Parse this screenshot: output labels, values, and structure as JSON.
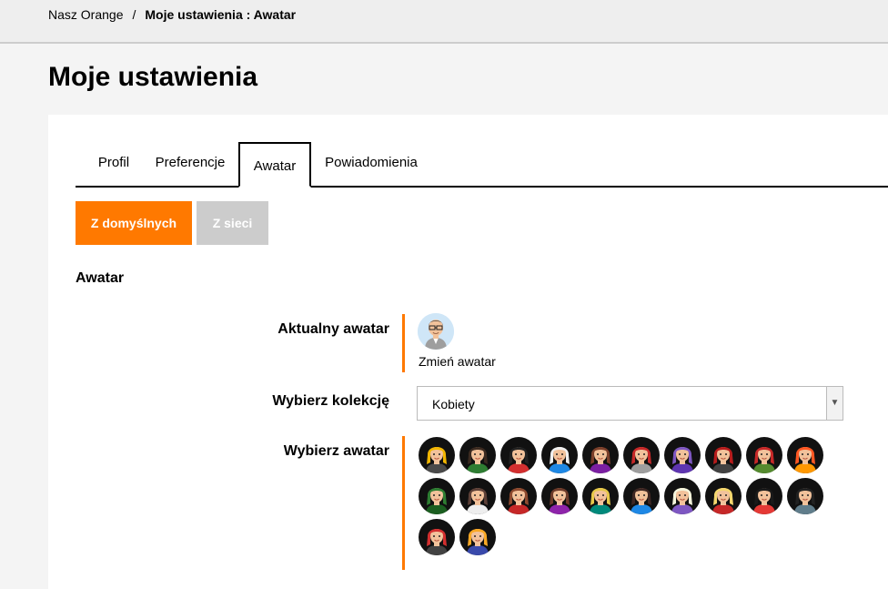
{
  "breadcrumb": {
    "home": "Nasz Orange",
    "separator": "/",
    "current": "Moje ustawienia : Awatar"
  },
  "page_title": "Moje ustawienia",
  "tabs": [
    {
      "label": "Profil",
      "active": false
    },
    {
      "label": "Preferencje",
      "active": false
    },
    {
      "label": "Awatar",
      "active": true
    },
    {
      "label": "Powiadomienia",
      "active": false
    }
  ],
  "source_buttons": {
    "defaults": "Z domyślnych",
    "web": "Z sieci"
  },
  "section_title": "Awatar",
  "current_avatar": {
    "label": "Aktualny awatar",
    "change_link": "Zmień awatar",
    "icon": "man-glasses-avatar-icon"
  },
  "collection": {
    "label": "Wybierz kolekcję",
    "selected": "Kobiety"
  },
  "avatar_picker": {
    "label": "Wybierz awatar",
    "avatars": [
      {
        "icon": "woman-avatar-1-icon",
        "hair": "#f2b600",
        "shirt": "#4a4a4a"
      },
      {
        "icon": "woman-avatar-2-icon",
        "hair": "#3b2a20",
        "shirt": "#2e7d32"
      },
      {
        "icon": "woman-avatar-3-icon",
        "hair": "#222222",
        "shirt": "#d32f2f"
      },
      {
        "icon": "woman-avatar-4-icon",
        "hair": "#f0f0f0",
        "shirt": "#1e88e5"
      },
      {
        "icon": "woman-avatar-5-icon",
        "hair": "#7b3f2a",
        "shirt": "#7b1fa2"
      },
      {
        "icon": "woman-avatar-6-icon",
        "hair": "#c62828",
        "shirt": "#9e9e9e"
      },
      {
        "icon": "woman-avatar-7-icon",
        "hair": "#7e57c2",
        "shirt": "#5e35b1"
      },
      {
        "icon": "woman-avatar-8-icon",
        "hair": "#b71c1c",
        "shirt": "#424242"
      },
      {
        "icon": "woman-avatar-9-icon",
        "hair": "#c62828",
        "shirt": "#558b2f"
      },
      {
        "icon": "woman-avatar-10-icon",
        "hair": "#ff5722",
        "shirt": "#ff9800"
      },
      {
        "icon": "woman-avatar-11-icon",
        "hair": "#2e7d32",
        "shirt": "#1b5e20"
      },
      {
        "icon": "woman-avatar-12-icon",
        "hair": "#5d4037",
        "shirt": "#eeeeee"
      },
      {
        "icon": "woman-avatar-13-icon",
        "hair": "#8d4a2f",
        "shirt": "#c62828"
      },
      {
        "icon": "woman-avatar-14-icon",
        "hair": "#6d3b2a",
        "shirt": "#8e24aa"
      },
      {
        "icon": "woman-avatar-15-icon",
        "hair": "#e6c84a",
        "shirt": "#00897b"
      },
      {
        "icon": "woman-avatar-16-icon",
        "hair": "#3e2723",
        "shirt": "#1e88e5"
      },
      {
        "icon": "woman-avatar-17-icon",
        "hair": "#f5f5dc",
        "shirt": "#7e57c2"
      },
      {
        "icon": "woman-avatar-18-icon",
        "hair": "#f5d76e",
        "shirt": "#c62828"
      },
      {
        "icon": "woman-avatar-19-icon",
        "hair": "#1a1a1a",
        "shirt": "#e53935"
      },
      {
        "icon": "woman-avatar-20-icon",
        "hair": "#212121",
        "shirt": "#607d8b"
      },
      {
        "icon": "woman-avatar-21-icon",
        "hair": "#d32f2f",
        "shirt": "#424242"
      },
      {
        "icon": "woman-avatar-22-icon",
        "hair": "#f9a825",
        "shirt": "#3949ab"
      }
    ]
  },
  "colors": {
    "accent": "#ff7900",
    "inactive_button": "#cccccc",
    "avatar_bg": "#111111",
    "skin": "#f2c29b"
  }
}
